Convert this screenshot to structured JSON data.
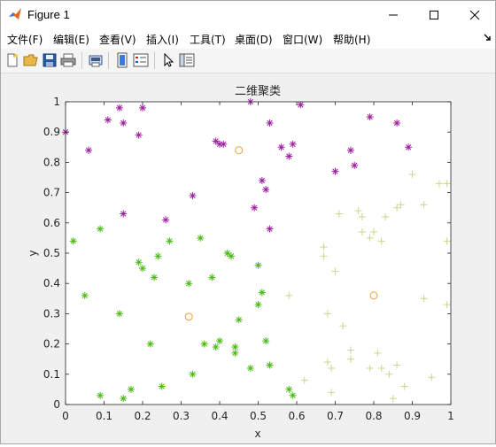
{
  "window": {
    "title": "Figure 1"
  },
  "menu": [
    "文件(F)",
    "编辑(E)",
    "查看(V)",
    "插入(I)",
    "工具(T)",
    "桌面(D)",
    "窗口(W)",
    "帮助(H)"
  ],
  "toolbar_icons": [
    "new-figure-icon",
    "open-file-icon",
    "save-icon",
    "print-icon",
    "print-preview-icon",
    "link-plot-icon",
    "insert-legend-icon",
    "edit-plot-arrow-icon",
    "property-inspector-icon"
  ],
  "chart_data": {
    "type": "scatter",
    "title": "二维聚类",
    "xlabel": "x",
    "ylabel": "y",
    "xlim": [
      0,
      1
    ],
    "ylim": [
      0,
      1
    ],
    "xticks": [
      "0",
      "0.1",
      "0.2",
      "0.3",
      "0.4",
      "0.5",
      "0.6",
      "0.7",
      "0.8",
      "0.9",
      "1"
    ],
    "yticks": [
      "0",
      "0.1",
      "0.2",
      "0.3",
      "0.4",
      "0.5",
      "0.6",
      "0.7",
      "0.8",
      "0.9",
      "1"
    ],
    "grid": false,
    "colors": {
      "magenta": "#a020a0",
      "green": "#4cbb17",
      "yellowgreen": "#c8d88a",
      "centroid": "#f0a030"
    },
    "series": [
      {
        "marker": "*",
        "color": "magenta",
        "points": [
          [
            0.0,
            0.9
          ],
          [
            0.06,
            0.84
          ],
          [
            0.11,
            0.94
          ],
          [
            0.14,
            0.98
          ],
          [
            0.15,
            0.93
          ],
          [
            0.19,
            0.89
          ],
          [
            0.2,
            0.98
          ],
          [
            0.15,
            0.63
          ],
          [
            0.26,
            0.61
          ],
          [
            0.33,
            0.69
          ],
          [
            0.39,
            0.87
          ],
          [
            0.4,
            0.86
          ],
          [
            0.41,
            0.86
          ],
          [
            0.48,
            1.0
          ],
          [
            0.49,
            0.65
          ],
          [
            0.51,
            0.74
          ],
          [
            0.52,
            0.71
          ],
          [
            0.53,
            0.93
          ],
          [
            0.53,
            0.58
          ],
          [
            0.56,
            0.85
          ],
          [
            0.58,
            0.82
          ],
          [
            0.59,
            0.86
          ],
          [
            0.61,
            0.99
          ],
          [
            0.7,
            0.77
          ],
          [
            0.74,
            0.84
          ],
          [
            0.75,
            0.79
          ],
          [
            0.79,
            0.95
          ],
          [
            0.86,
            0.93
          ],
          [
            0.89,
            0.85
          ]
        ]
      },
      {
        "marker": "*",
        "color": "green",
        "points": [
          [
            0.02,
            0.54
          ],
          [
            0.05,
            0.36
          ],
          [
            0.09,
            0.58
          ],
          [
            0.09,
            0.03
          ],
          [
            0.14,
            0.3
          ],
          [
            0.15,
            0.02
          ],
          [
            0.17,
            0.05
          ],
          [
            0.19,
            0.47
          ],
          [
            0.2,
            0.45
          ],
          [
            0.22,
            0.2
          ],
          [
            0.23,
            0.42
          ],
          [
            0.24,
            0.49
          ],
          [
            0.25,
            0.06
          ],
          [
            0.27,
            0.54
          ],
          [
            0.32,
            0.4
          ],
          [
            0.33,
            0.1
          ],
          [
            0.35,
            0.55
          ],
          [
            0.36,
            0.2
          ],
          [
            0.38,
            0.42
          ],
          [
            0.39,
            0.19
          ],
          [
            0.4,
            0.21
          ],
          [
            0.42,
            0.5
          ],
          [
            0.43,
            0.49
          ],
          [
            0.44,
            0.17
          ],
          [
            0.44,
            0.19
          ],
          [
            0.45,
            0.28
          ],
          [
            0.48,
            0.12
          ],
          [
            0.5,
            0.46
          ],
          [
            0.5,
            0.33
          ],
          [
            0.51,
            0.37
          ],
          [
            0.52,
            0.21
          ],
          [
            0.53,
            0.13
          ],
          [
            0.58,
            0.05
          ],
          [
            0.59,
            0.03
          ]
        ]
      },
      {
        "marker": "+",
        "color": "yellowgreen",
        "points": [
          [
            0.58,
            0.36
          ],
          [
            0.62,
            0.08
          ],
          [
            0.67,
            0.52
          ],
          [
            0.67,
            0.49
          ],
          [
            0.68,
            0.3
          ],
          [
            0.68,
            0.14
          ],
          [
            0.69,
            0.04
          ],
          [
            0.69,
            0.12
          ],
          [
            0.7,
            0.44
          ],
          [
            0.71,
            0.63
          ],
          [
            0.72,
            0.26
          ],
          [
            0.74,
            0.18
          ],
          [
            0.74,
            0.15
          ],
          [
            0.76,
            0.64
          ],
          [
            0.77,
            0.62
          ],
          [
            0.77,
            0.57
          ],
          [
            0.79,
            0.55
          ],
          [
            0.79,
            0.12
          ],
          [
            0.8,
            0.57
          ],
          [
            0.81,
            0.17
          ],
          [
            0.82,
            0.54
          ],
          [
            0.82,
            0.12
          ],
          [
            0.83,
            0.62
          ],
          [
            0.84,
            0.1
          ],
          [
            0.85,
            0.02
          ],
          [
            0.86,
            0.65
          ],
          [
            0.86,
            0.13
          ],
          [
            0.87,
            0.66
          ],
          [
            0.88,
            0.06
          ],
          [
            0.9,
            0.76
          ],
          [
            0.93,
            0.66
          ],
          [
            0.93,
            0.35
          ],
          [
            0.95,
            0.09
          ],
          [
            0.97,
            0.73
          ],
          [
            0.99,
            0.73
          ],
          [
            0.99,
            0.54
          ],
          [
            0.99,
            0.33
          ]
        ]
      },
      {
        "marker": "o",
        "color": "centroid",
        "points": [
          [
            0.32,
            0.29
          ],
          [
            0.45,
            0.84
          ],
          [
            0.8,
            0.36
          ]
        ]
      }
    ]
  }
}
